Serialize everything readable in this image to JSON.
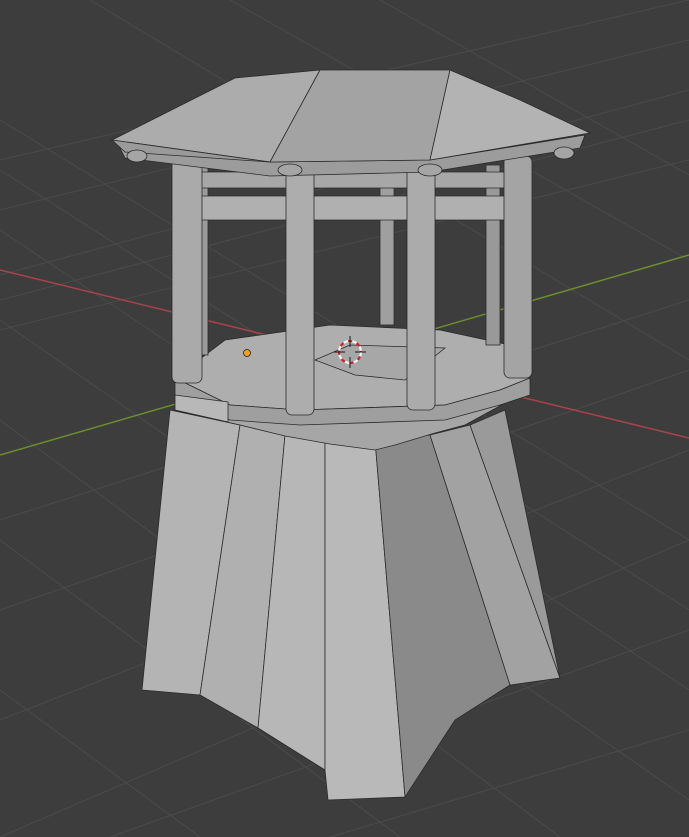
{
  "viewport": {
    "background_color": "#3d3d3d",
    "grid_color": "#4b4b4b",
    "x_axis_color": "#a8434d",
    "y_axis_color": "#6b8e2f"
  },
  "object": {
    "base_color": "#b5b5b5",
    "roof_color": "#a9a9a9",
    "post_color": "#a3a3a3",
    "edge_color": "#2b2b2b"
  },
  "overlays": {
    "origin_color": "#f0a020",
    "cursor_red": "#d02020",
    "cursor_white": "#f2f2f2"
  }
}
